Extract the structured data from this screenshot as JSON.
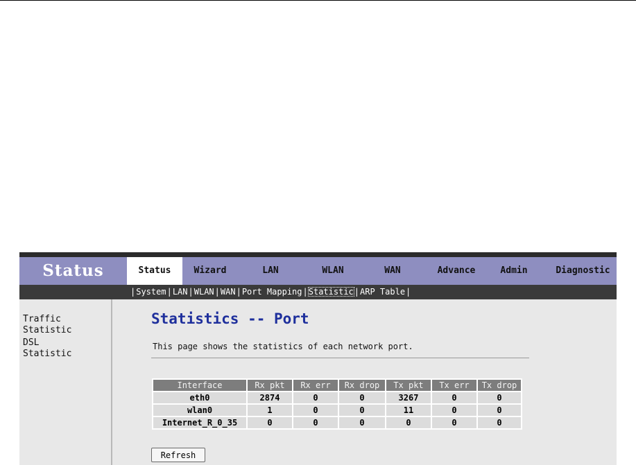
{
  "brand": "Status",
  "main_tabs": [
    {
      "label": "Status",
      "active": true
    },
    {
      "label": "Wizard"
    },
    {
      "label": "LAN"
    },
    {
      "label": "WLAN"
    },
    {
      "label": "WAN"
    },
    {
      "label": "Advance"
    },
    {
      "label": "Admin"
    },
    {
      "label": "Diagnostic"
    }
  ],
  "sub_tabs": [
    "System",
    "LAN",
    "WLAN",
    "WAN",
    "Port Mapping",
    "Statistic",
    "ARP Table"
  ],
  "active_sub_tab": "Statistic",
  "sidebar": {
    "items": [
      "Traffic Statistic",
      "DSL Statistic"
    ]
  },
  "page": {
    "title": "Statistics -- Port",
    "description": "This page shows the statistics of each network port."
  },
  "table": {
    "headers": [
      "Interface",
      "Rx pkt",
      "Rx err",
      "Rx drop",
      "Tx pkt",
      "Tx err",
      "Tx drop"
    ],
    "rows": [
      [
        "eth0",
        "2874",
        "0",
        "0",
        "3267",
        "0",
        "0"
      ],
      [
        "wlan0",
        "1",
        "0",
        "0",
        "11",
        "0",
        "0"
      ],
      [
        "Internet_R_0_35",
        "0",
        "0",
        "0",
        "0",
        "0",
        "0"
      ]
    ]
  },
  "refresh_label": "Refresh",
  "colors": {
    "header_bg": "#8e8ec0",
    "subnav_bg": "#3a3a3a",
    "title_color": "#1e2f9c",
    "table_header_bg": "#7d7d7d",
    "table_cell_bg": "#dcdcdc"
  }
}
